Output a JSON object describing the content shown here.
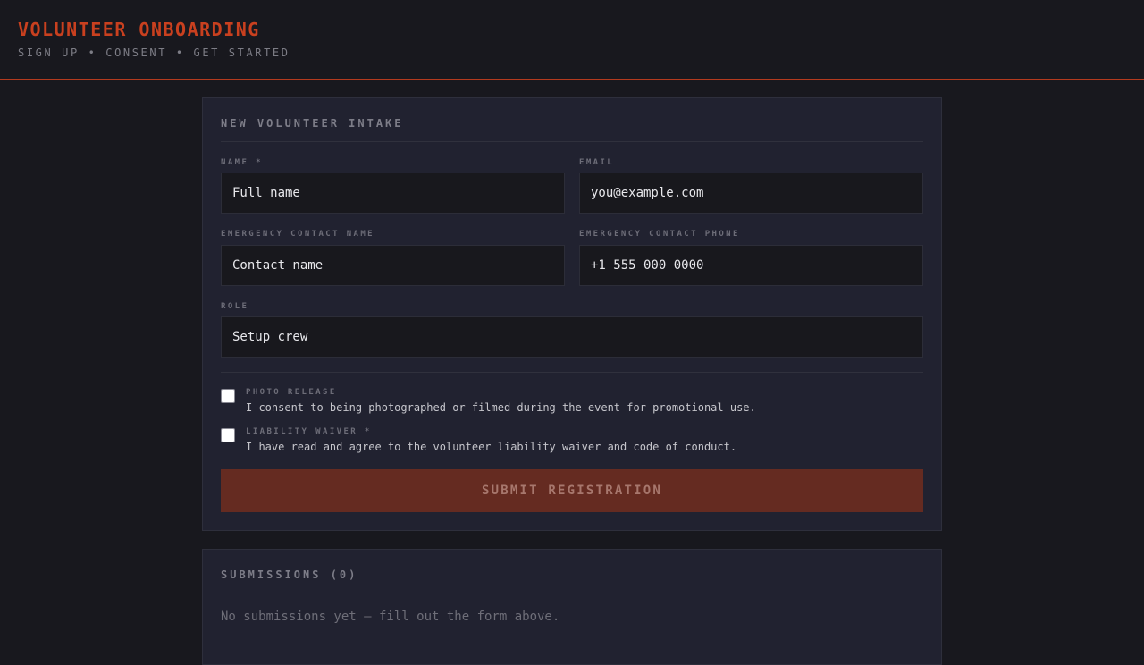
{
  "header": {
    "title": "VOLUNTEER ONBOARDING",
    "subtitle": "SIGN UP • CONSENT • GET STARTED"
  },
  "intake": {
    "title": "NEW VOLUNTEER INTAKE",
    "fields": {
      "name": {
        "label": "NAME *",
        "placeholder": "Full name",
        "value": ""
      },
      "email": {
        "label": "EMAIL",
        "placeholder": "you@example.com",
        "value": ""
      },
      "emergency_name": {
        "label": "EMERGENCY CONTACT NAME",
        "placeholder": "Contact name",
        "value": ""
      },
      "emergency_phone": {
        "label": "EMERGENCY CONTACT PHONE",
        "placeholder": "+1 555 000 0000",
        "value": ""
      },
      "role": {
        "label": "ROLE",
        "placeholder": "Setup crew",
        "value": ""
      }
    },
    "consents": {
      "photo": {
        "title": "PHOTO RELEASE",
        "text": "I consent to being photographed or filmed during the event for promotional use.",
        "checked": false
      },
      "waiver": {
        "title": "LIABILITY WAIVER *",
        "text": "I have read and agree to the volunteer liability waiver and code of conduct.",
        "checked": false
      }
    },
    "submit_label": "SUBMIT REGISTRATION"
  },
  "submissions": {
    "title": "SUBMISSIONS (0)",
    "empty_message": "No submissions yet — fill out the form above."
  }
}
